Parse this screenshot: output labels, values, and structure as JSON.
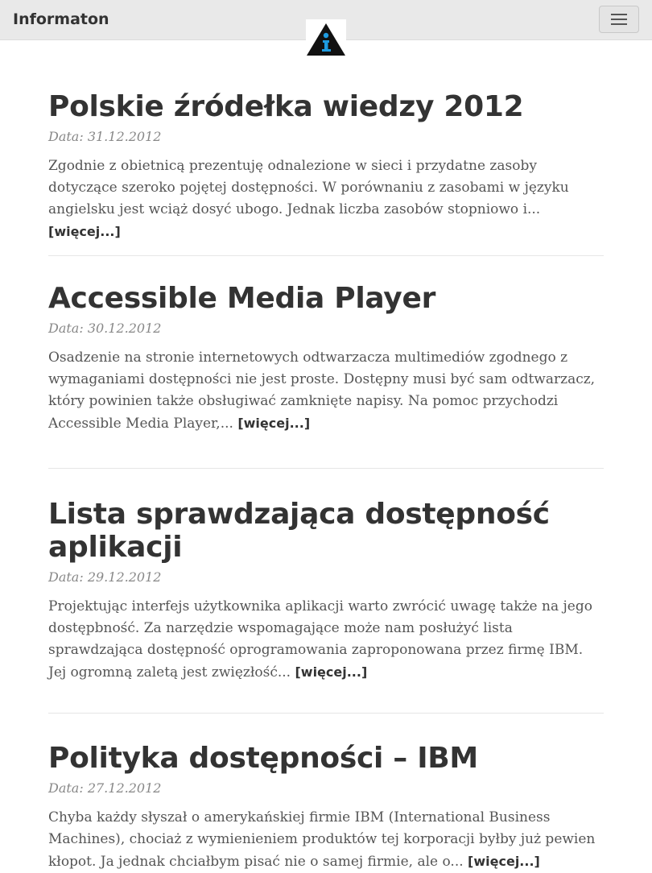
{
  "navbar": {
    "brand": "Informaton",
    "logo_icon": "information-triangle-icon",
    "menu_icon": "hamburger-menu-icon"
  },
  "posts": [
    {
      "title": "Polskie źródełka wiedzy 2012",
      "date": "Data: 31.12.2012",
      "excerpt": "Zgodnie z obietnicą prezentuję odnalezione w sieci i przydatne zasoby dotyczące szeroko pojętej dostępności. W porównaniu z zasobami w języku angielsku jest wciąż dosyć ubogo. Jednak liczba zasobów stopniowo i... ",
      "more": "[więcej...]"
    },
    {
      "title": "Accessible Media Player",
      "date": "Data: 30.12.2012",
      "excerpt": "Osadzenie na stronie internetowych odtwarzacza multimediów zgodnego z wymaganiami dostępności nie jest proste. Dostępny musi być sam odtwarzacz, który powinien także obsługiwać zamknięte napisy. Na pomoc przychodzi Accessible Media Player,... ",
      "more": "[więcej...]"
    },
    {
      "title": "Lista sprawdzająca dostępność aplikacji",
      "date": "Data: 29.12.2012",
      "excerpt": "Projektując interfejs użytkownika aplikacji warto zwrócić uwagę także na jego dostępbność. Za narzędzie wspomagające może nam posłużyć lista sprawdzająca dostępność oprogramowania zaproponowana przez firmę IBM. Jej ogromną zaletą jest zwięzłość... ",
      "more": "[więcej...]"
    },
    {
      "title": "Polityka dostępności – IBM",
      "date": "Data: 27.12.2012",
      "excerpt": "Chyba każdy słyszał o amerykańskiej firmie IBM (International Business Machines), chociaż z wymienieniem produktów tej korporacji byłby już pewien kłopot. Ja jednak chciałbym pisać nie o samej firmie, ale o... ",
      "more": "[więcej...]"
    }
  ]
}
